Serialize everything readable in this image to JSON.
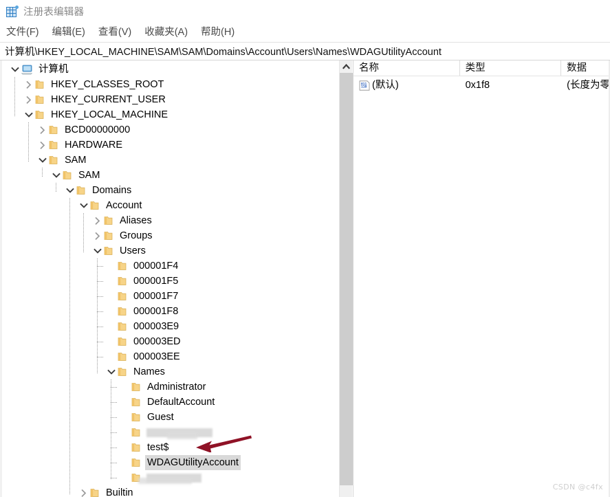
{
  "window": {
    "title": "注册表编辑器",
    "icon": "registry-editor-icon"
  },
  "menubar": {
    "items": [
      {
        "label": "文件(F)"
      },
      {
        "label": "编辑(E)"
      },
      {
        "label": "查看(V)"
      },
      {
        "label": "收藏夹(A)"
      },
      {
        "label": "帮助(H)"
      }
    ]
  },
  "address_bar": {
    "value": "计算机\\HKEY_LOCAL_MACHINE\\SAM\\SAM\\Domains\\Account\\Users\\Names\\WDAGUtilityAccount"
  },
  "tree": {
    "nodes": [
      {
        "label": "计算机",
        "depth": 0,
        "state": "expanded",
        "icon": "computer-icon"
      },
      {
        "label": "HKEY_CLASSES_ROOT",
        "depth": 1,
        "state": "collapsed",
        "icon": "folder-icon"
      },
      {
        "label": "HKEY_CURRENT_USER",
        "depth": 1,
        "state": "collapsed",
        "icon": "folder-icon"
      },
      {
        "label": "HKEY_LOCAL_MACHINE",
        "depth": 1,
        "state": "expanded",
        "icon": "folder-icon"
      },
      {
        "label": "BCD00000000",
        "depth": 2,
        "state": "collapsed",
        "icon": "folder-icon"
      },
      {
        "label": "HARDWARE",
        "depth": 2,
        "state": "collapsed",
        "icon": "folder-icon"
      },
      {
        "label": "SAM",
        "depth": 2,
        "state": "expanded",
        "icon": "folder-icon"
      },
      {
        "label": "SAM",
        "depth": 3,
        "state": "expanded",
        "icon": "folder-icon"
      },
      {
        "label": "Domains",
        "depth": 4,
        "state": "expanded",
        "icon": "folder-icon"
      },
      {
        "label": "Account",
        "depth": 5,
        "state": "expanded",
        "icon": "folder-icon"
      },
      {
        "label": "Aliases",
        "depth": 6,
        "state": "collapsed",
        "icon": "folder-icon"
      },
      {
        "label": "Groups",
        "depth": 6,
        "state": "collapsed",
        "icon": "folder-icon"
      },
      {
        "label": "Users",
        "depth": 6,
        "state": "expanded",
        "icon": "folder-icon"
      },
      {
        "label": "000001F4",
        "depth": 7,
        "state": "leaf",
        "icon": "folder-icon"
      },
      {
        "label": "000001F5",
        "depth": 7,
        "state": "leaf",
        "icon": "folder-icon"
      },
      {
        "label": "000001F7",
        "depth": 7,
        "state": "leaf",
        "icon": "folder-icon"
      },
      {
        "label": "000001F8",
        "depth": 7,
        "state": "leaf",
        "icon": "folder-icon"
      },
      {
        "label": "000003E9",
        "depth": 7,
        "state": "leaf",
        "icon": "folder-icon"
      },
      {
        "label": "000003ED",
        "depth": 7,
        "state": "leaf",
        "icon": "folder-icon"
      },
      {
        "label": "000003EE",
        "depth": 7,
        "state": "leaf",
        "icon": "folder-icon"
      },
      {
        "label": "Names",
        "depth": 7,
        "state": "expanded",
        "icon": "folder-icon"
      },
      {
        "label": "Administrator",
        "depth": 8,
        "state": "leaf",
        "icon": "folder-icon"
      },
      {
        "label": "DefaultAccount",
        "depth": 8,
        "state": "leaf",
        "icon": "folder-icon"
      },
      {
        "label": "Guest",
        "depth": 8,
        "state": "leaf",
        "icon": "folder-icon"
      },
      {
        "label": "",
        "depth": 8,
        "state": "leaf",
        "icon": "folder-icon",
        "redacted": true,
        "redact_w": 96
      },
      {
        "label": "test$",
        "depth": 8,
        "state": "leaf",
        "icon": "folder-icon"
      },
      {
        "label": "WDAGUtilityAccount",
        "depth": 8,
        "state": "leaf",
        "icon": "folder-icon",
        "selected": true
      },
      {
        "label": "",
        "depth": 8,
        "state": "leaf",
        "icon": "folder-icon",
        "redacted": true,
        "redact_w": 80
      },
      {
        "label": "Builtin",
        "depth": 5,
        "state": "collapsed",
        "icon": "folder-icon"
      }
    ]
  },
  "value_list": {
    "columns": [
      {
        "label": "名称"
      },
      {
        "label": "类型"
      },
      {
        "label": "数据"
      }
    ],
    "rows": [
      {
        "name": "(默认)",
        "type": "0x1f8",
        "data": "(长度为零",
        "icon": "string-value-icon"
      }
    ]
  },
  "annotation": {
    "arrow_color": "#8f1226",
    "direction": "left",
    "points_to": "test$"
  },
  "watermark": {
    "text": "CSDN @c4fx"
  },
  "colors": {
    "folder": "#f5ce7a",
    "selection": "#d9d9d9",
    "title_text": "#8a8a8a",
    "arrow": "#8f1226"
  }
}
